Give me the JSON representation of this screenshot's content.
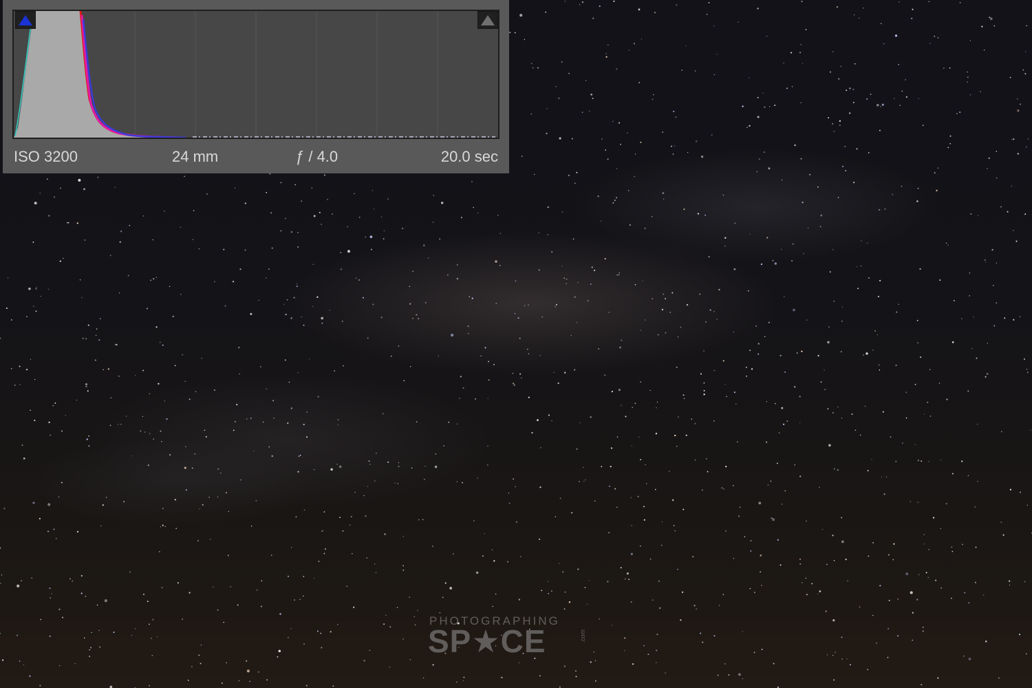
{
  "histogram": {
    "shadow_clip_icon": "triangle-up-icon",
    "highlight_clip_icon": "triangle-up-icon",
    "shadow_clip_color": "#1a33d6",
    "highlight_clip_color": "#707070",
    "exif": {
      "iso": "ISO 3200",
      "focal_length": "24 mm",
      "aperture": "ƒ / 4.0",
      "shutter": "20.0 sec"
    }
  },
  "watermark": {
    "line1": "PHOTOGRAPHING",
    "line2": "SP★CE",
    "suffix": ".com"
  }
}
